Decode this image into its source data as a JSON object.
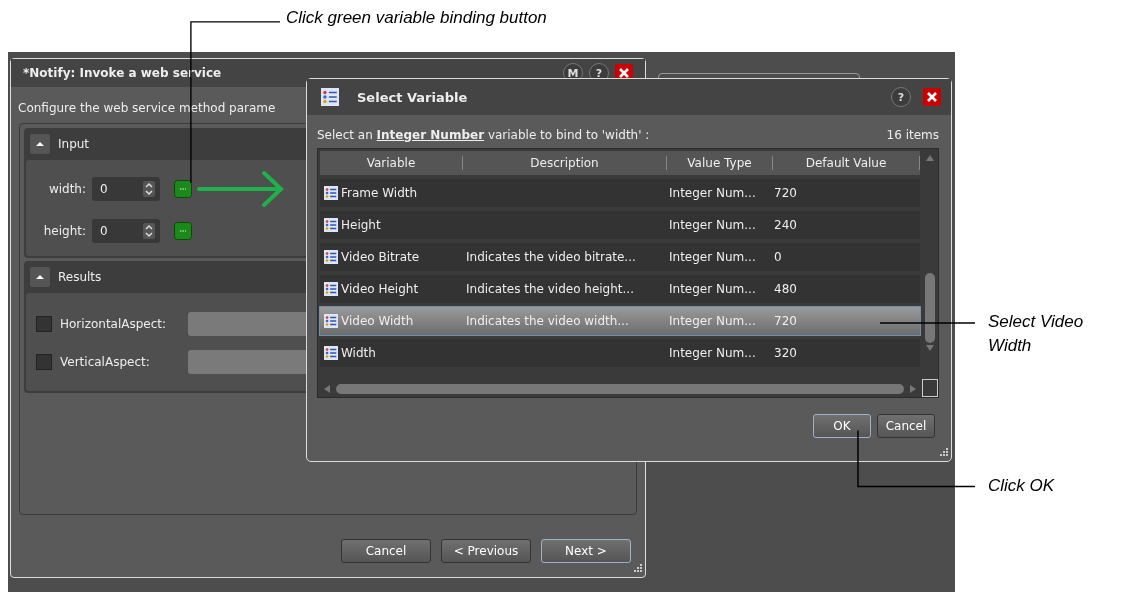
{
  "annotations": [
    {
      "text": "Click green variable binding button"
    },
    {
      "text": "Select Video Width"
    },
    {
      "text": "Click OK"
    }
  ],
  "main_dialog": {
    "title": "*Notify: Invoke a web service",
    "title_buttons": [
      "M",
      "?"
    ],
    "description": "Configure the web service method parame",
    "input": {
      "header": "Input",
      "fields": [
        {
          "label": "width:",
          "value": "0"
        },
        {
          "label": "height:",
          "value": "0"
        }
      ]
    },
    "results": {
      "header": "Results",
      "items": [
        {
          "label": "HorizontalAspect:",
          "checked": false
        },
        {
          "label": "VerticalAspect:",
          "checked": false
        }
      ]
    },
    "buttons": [
      {
        "label": "Cancel",
        "default": false
      },
      {
        "label": "< Previous",
        "default": false
      },
      {
        "label": "Next >",
        "default": true
      }
    ]
  },
  "select_dialog": {
    "title": "Select Variable",
    "help": "?",
    "prompt": "Select an **Integer Number** variable to bind to 'width' :",
    "count": "16 items",
    "columns": [
      "Variable",
      "Description",
      "Value Type",
      "Default Value"
    ],
    "rows": [
      {
        "cells": [
          "Frame Width",
          "",
          "Integer Num...",
          "720"
        ],
        "selected": false
      },
      {
        "cells": [
          "Height",
          "",
          "Integer Num...",
          "240"
        ],
        "selected": false
      },
      {
        "cells": [
          "Video Bitrate",
          "Indicates the video bitrate...",
          "Integer Num...",
          "0"
        ],
        "selected": false
      },
      {
        "cells": [
          "Video Height",
          "Indicates the video height...",
          "Integer Num...",
          "480"
        ],
        "selected": false
      },
      {
        "cells": [
          "Video Width",
          "Indicates the video width...",
          "Integer Num...",
          "720"
        ],
        "selected": true
      },
      {
        "cells": [
          "Width",
          "",
          "Integer Num...",
          "320"
        ],
        "selected": false
      }
    ],
    "buttons": [
      {
        "label": "OK",
        "default": true
      },
      {
        "label": "Cancel",
        "default": false
      }
    ]
  }
}
